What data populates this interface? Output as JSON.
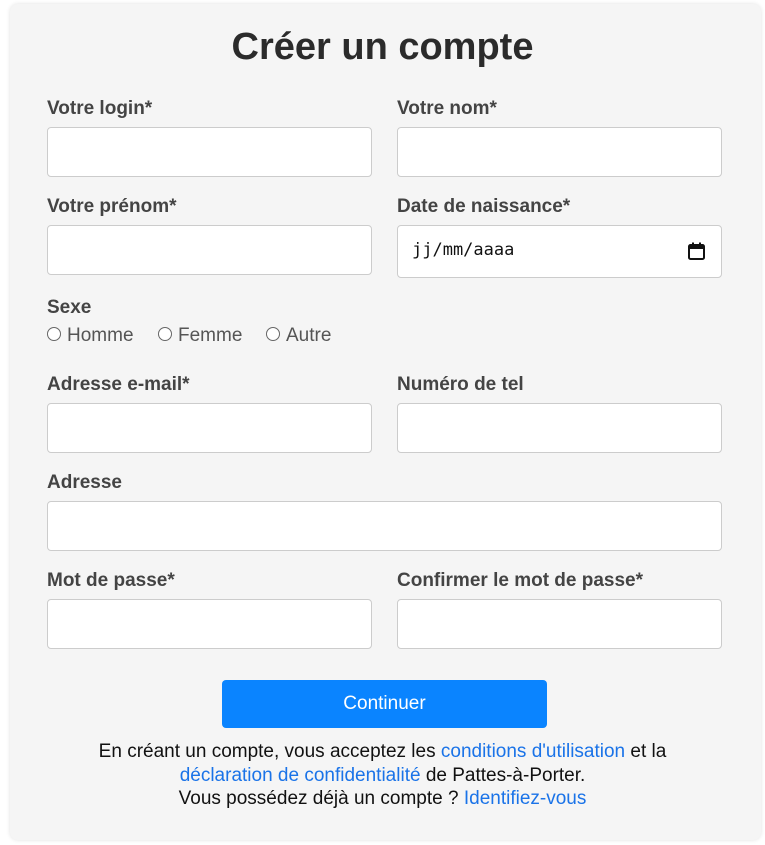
{
  "title": "Créer un compte",
  "fields": {
    "login": {
      "label": "Votre login*",
      "value": ""
    },
    "nom": {
      "label": "Votre nom*",
      "value": ""
    },
    "prenom": {
      "label": "Votre prénom*",
      "value": ""
    },
    "naissance": {
      "label": "Date de naissance*",
      "value": "jj/mm/aaaa"
    },
    "email": {
      "label": "Adresse e-mail*",
      "value": ""
    },
    "tel": {
      "label": "Numéro de tel",
      "value": ""
    },
    "adresse": {
      "label": "Adresse",
      "value": ""
    },
    "mdp": {
      "label": "Mot de passe*",
      "value": ""
    },
    "mdp_confirm": {
      "label": "Confirmer le mot de passe*",
      "value": ""
    }
  },
  "sexe": {
    "label": "Sexe",
    "options": [
      "Homme",
      "Femme",
      "Autre"
    ]
  },
  "submit_label": "Continuer",
  "terms": {
    "prefix": "En créant un compte, vous acceptez les",
    "conditions_link": "conditions d'utilisation",
    "middle": "et la",
    "privacy_link": "déclaration de confidentialité",
    "suffix": "de Pattes-à-Porter.",
    "have_account": "Vous possédez déjà un compte ?",
    "login_link": "Identifiez-vous"
  },
  "colors": {
    "accent": "#0a84ff",
    "link": "#1a73e8",
    "card": "#f5f5f5"
  }
}
